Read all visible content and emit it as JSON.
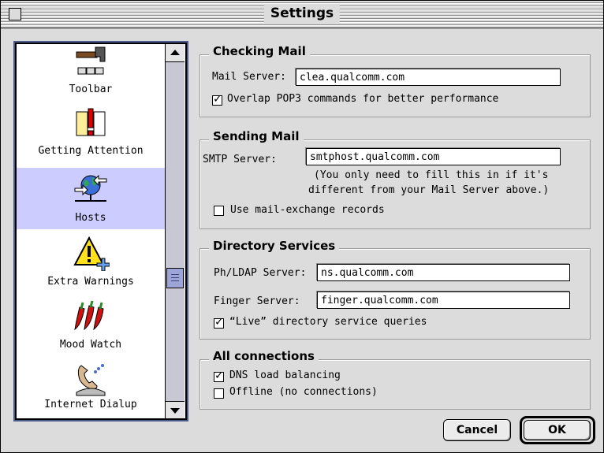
{
  "window": {
    "title": "Settings"
  },
  "sidebar": {
    "items": [
      {
        "label": "Toolbar",
        "icon": "hammer-toolbar-icon",
        "selected": false
      },
      {
        "label": "Getting Attention",
        "icon": "exclamation-note-icon",
        "selected": false
      },
      {
        "label": "Hosts",
        "icon": "globe-network-icon",
        "selected": true
      },
      {
        "label": "Extra Warnings",
        "icon": "warning-triangle-icon",
        "selected": false
      },
      {
        "label": "Mood Watch",
        "icon": "chili-peppers-icon",
        "selected": false
      },
      {
        "label": "Internet Dialup",
        "icon": "telephone-handset-icon",
        "selected": false
      }
    ]
  },
  "checking_mail": {
    "heading": "Checking Mail",
    "mail_server_label": "Mail Server:",
    "mail_server_value": "clea.qualcomm.com",
    "overlap_label": "Overlap POP3 commands for better performance",
    "overlap_checked": true
  },
  "sending_mail": {
    "heading": "Sending Mail",
    "smtp_label": "SMTP Server:",
    "smtp_value": "smtphost.qualcomm.com",
    "note_line1": "(You only need to fill this in if it's",
    "note_line2": "different from your Mail Server above.)",
    "mx_label": "Use mail-exchange records",
    "mx_checked": false
  },
  "directory_services": {
    "heading": "Directory Services",
    "ph_label": "Ph/LDAP Server:",
    "ph_value": "ns.qualcomm.com",
    "finger_label": "Finger Server:",
    "finger_value": "finger.qualcomm.com",
    "live_label": "“Live” directory service queries",
    "live_checked": true
  },
  "all_connections": {
    "heading": "All connections",
    "dns_label": "DNS load balancing",
    "dns_checked": true,
    "offline_label": "Offline (no connections)",
    "offline_checked": false
  },
  "buttons": {
    "cancel": "Cancel",
    "ok": "OK"
  }
}
